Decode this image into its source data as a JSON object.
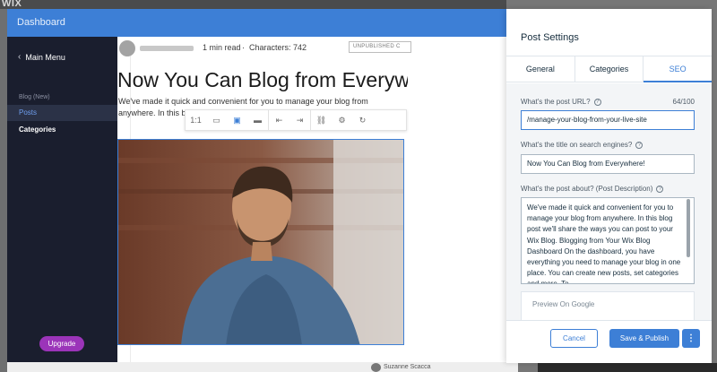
{
  "app": {
    "logo": "WIX"
  },
  "dashboard": {
    "title": "Dashboard",
    "sidebar": {
      "back_label": "Main Menu",
      "section": "Blog (New)",
      "items": [
        {
          "label": "Posts",
          "active": true
        },
        {
          "label": "Categories",
          "active": false
        }
      ],
      "upgrade_label": "Upgrade"
    }
  },
  "editor": {
    "read_time": "1 min read",
    "characters": "Characters: 742",
    "status_badge": "UNPUBLISHED C",
    "post_title": "Now You Can Blog from Everyw",
    "excerpt": "We've made it quick and convenient for you to manage your blog from anywhere. In this blog post we'll share the ways you",
    "toolbar": [
      {
        "icon": "original-size-icon",
        "glyph": "1:1"
      },
      {
        "icon": "align-small-icon",
        "glyph": "▭"
      },
      {
        "icon": "best-fit-icon",
        "glyph": "▣"
      },
      {
        "icon": "full-width-icon",
        "glyph": "▬"
      },
      {
        "icon": "align-left-icon",
        "glyph": "⇤"
      },
      {
        "icon": "align-right-icon",
        "glyph": "⇥"
      },
      {
        "icon": "link-icon",
        "glyph": "⛓"
      },
      {
        "icon": "settings-icon",
        "glyph": "⚙"
      },
      {
        "icon": "replace-icon",
        "glyph": "↻"
      }
    ],
    "byline": "Suzanne Scacca"
  },
  "panel": {
    "title": "Post Settings",
    "tabs": [
      {
        "label": "General",
        "active": false
      },
      {
        "label": "Categories",
        "active": false
      },
      {
        "label": "SEO",
        "active": true
      }
    ],
    "url_label": "What's the post URL?",
    "url_count": "64/100",
    "url_value": "/manage-your-blog-from-your-live-site",
    "seo_title_label": "What's the title on search engines?",
    "seo_title_value": "Now You Can Blog from Everywhere!",
    "desc_label": "What's the post about? (Post Description)",
    "desc_value": "We've made it quick and convenient for you to manage your blog from anywhere. In this blog post we'll share the ways you can post to your Wix Blog. Blogging from Your Wix Blog Dashboard On the dashboard, you have everything you need to manage your blog in one place. You can create new posts, set categories and more. To",
    "google_preview": "Preview On Google",
    "cancel_label": "Cancel",
    "publish_label": "Save & Publish",
    "more_label": "⋮"
  }
}
